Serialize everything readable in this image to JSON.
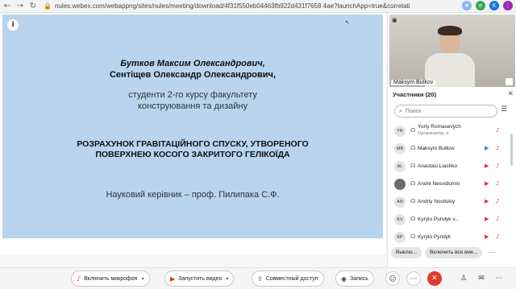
{
  "browser": {
    "back_icon": "arrow-left",
    "forward_icon": "arrow-right",
    "reload_icon": "reload",
    "url": "nules.webex.com/webappng/sites/nules/meeting/download/4f31f550eb04463fb922d431f7658 4ae?launchApp=true&correlatio..."
  },
  "slide": {
    "author_1": "Бутков Максим Олександрович,",
    "author_2": "Сентіщев Олександр Олександрович,",
    "students_line": "студенти 2-го курсу факультету",
    "department_line": "конструювання та дизайну",
    "title_line_1": "РОЗРАХУНОК ГРАВІТАЦІЙНОГО СПУСКУ, УТВОРЕНОГО",
    "title_line_2": "ПОВЕРХНЕЮ КОСОГО ЗАКРИТОГО ГЕЛІКОЇДА",
    "supervisor": "Науковий керівник – проф. Пилипака С.Ф."
  },
  "video": {
    "name": "Maksym Butkov"
  },
  "participants": {
    "title": "Участники (20)",
    "search_placeholder": "Поиск",
    "items": [
      {
        "initials": "YR",
        "name": "Yuriy Romasevych",
        "subtitle": "Организатор, я",
        "has_video": false
      },
      {
        "initials": "MB",
        "name": "Maksym Butkov",
        "subtitle": "",
        "has_video": true
      },
      {
        "initials": "AL",
        "name": "Anastasi Liashko",
        "subtitle": "",
        "has_video": true
      },
      {
        "initials": "",
        "name": "Andrii Nesvidomin",
        "subtitle": "",
        "has_video": true
      },
      {
        "initials": "AN",
        "name": "Andriy Novitskiy",
        "subtitle": "",
        "has_video": true
      },
      {
        "initials": "KV",
        "name": "Kyrylo Pundyk v...",
        "subtitle": "",
        "has_video": true
      },
      {
        "initials": "KP",
        "name": "Kyrylo Pyndyk",
        "subtitle": "",
        "has_video": true
      }
    ],
    "mute_all_label": "Выклю...",
    "unmute_all_label": "Включить все мик..."
  },
  "toolbar": {
    "mic_label": "Включить микрофон",
    "video_label": "Запустить видео",
    "share_label": "Совместный доступ",
    "record_label": "Запись"
  },
  "colors": {
    "slide_bg": "#b8d4ef",
    "mute_red": "#d33333",
    "video_orange": "#e8741c",
    "leave_red": "#e0392e"
  }
}
